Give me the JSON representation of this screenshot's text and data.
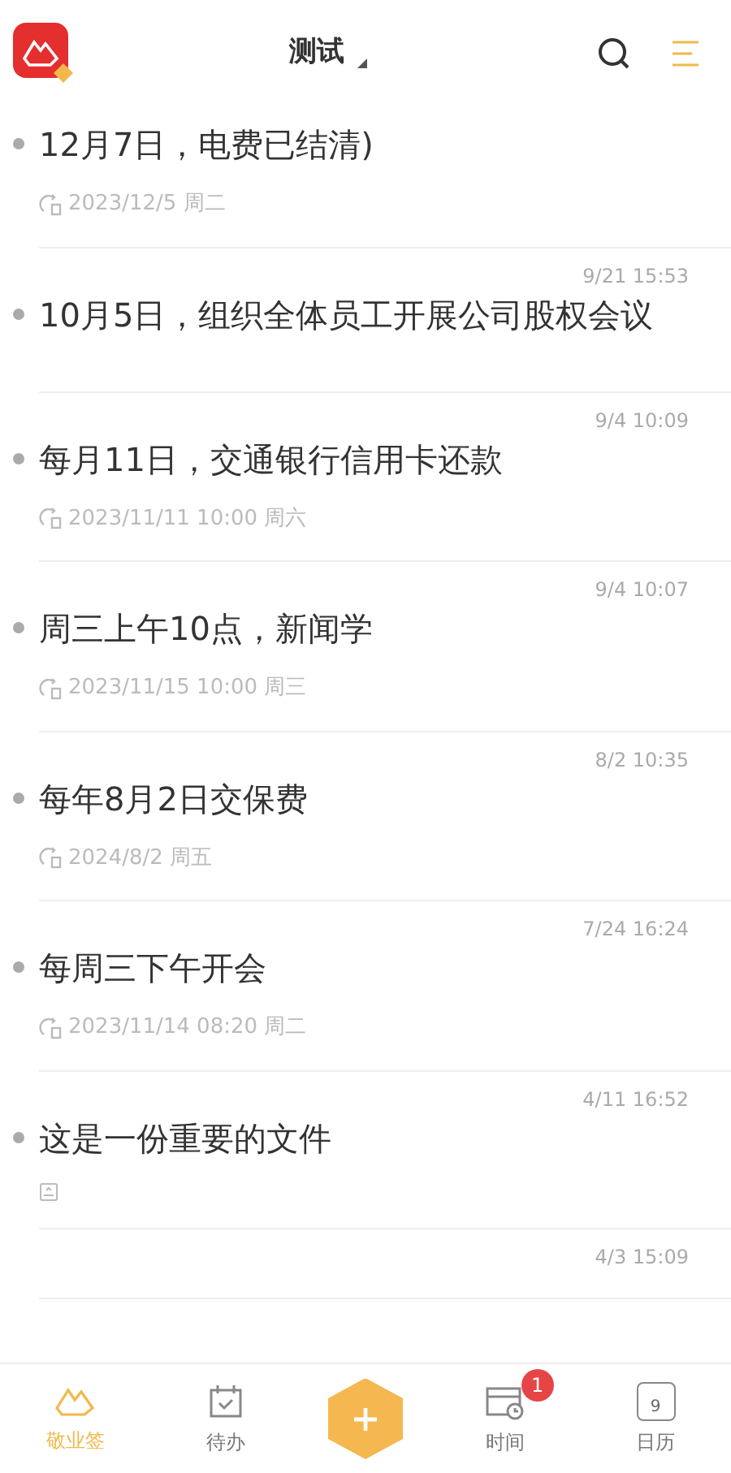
{
  "header": {
    "title": "测试"
  },
  "notes": [
    {
      "title": "12月7日，电费已结清)",
      "kind": "reminder",
      "reminder": "2023/12/5 周二"
    },
    {
      "time": "9/21 15:53",
      "title": "10月5日，组织全体员工开展公司股权会议",
      "kind": "none"
    },
    {
      "time": "9/4 10:09",
      "title": "每月11日，交通银行信用卡还款",
      "kind": "reminder",
      "reminder": "2023/11/11 10:00 周六"
    },
    {
      "time": "9/4 10:07",
      "title": "周三上午10点，新闻学",
      "kind": "reminder",
      "reminder": "2023/11/15 10:00 周三"
    },
    {
      "time": "8/2 10:35",
      "title": "每年8月2日交保费",
      "kind": "reminder",
      "reminder": "2024/8/2 周五"
    },
    {
      "time": "7/24 16:24",
      "title": "每周三下午开会",
      "kind": "reminder",
      "reminder": "2023/11/14 08:20 周二"
    },
    {
      "time": "4/11 16:52",
      "title": "这是一份重要的文件",
      "kind": "attachment"
    },
    {
      "time": "4/3 15:09",
      "kind": "cut"
    }
  ],
  "tabs": [
    {
      "label": "敬业签",
      "selected": true,
      "kind": "notes"
    },
    {
      "label": "待办",
      "selected": false,
      "kind": "todo"
    },
    {
      "kind": "add"
    },
    {
      "label": "时间",
      "selected": false,
      "kind": "time",
      "badge": "1"
    },
    {
      "label": "日历",
      "selected": false,
      "kind": "calendar",
      "day": "9"
    }
  ]
}
